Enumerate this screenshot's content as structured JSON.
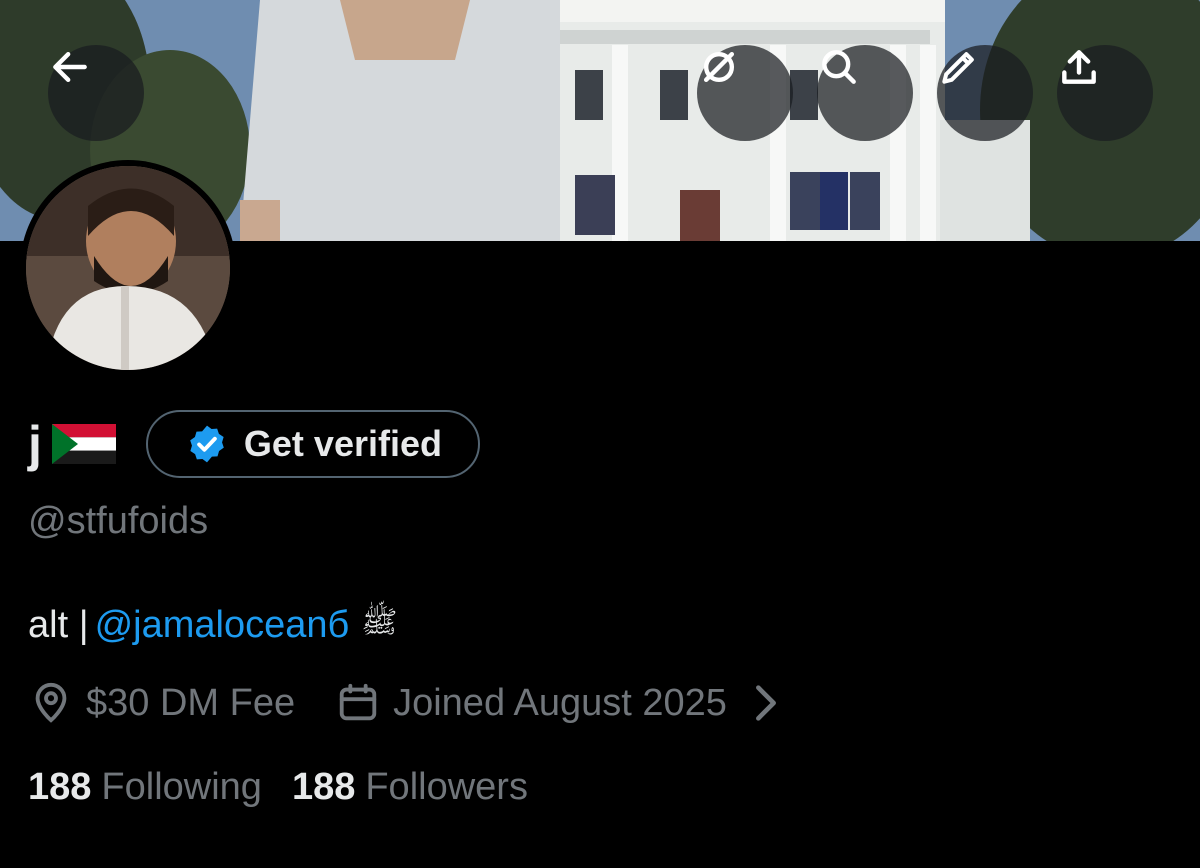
{
  "profile": {
    "display_name": "j",
    "flag_emoji": "sudan-flag",
    "get_verified_label": "Get verified",
    "handle": "@stfufoids",
    "bio_prefix": "alt |",
    "bio_mention": "@jamaloceanб",
    "bio_symbol": "ﷺ",
    "location": "$30 DM Fee",
    "joined": "Joined August 2025",
    "following_count": "188",
    "following_label": "Following",
    "followers_count": "188",
    "followers_label": "Followers"
  },
  "header_icons": [
    "back-arrow-icon",
    "grok-icon",
    "search-icon",
    "pencil-icon",
    "share-icon"
  ],
  "colors": {
    "background": "#000000",
    "primary_text": "#e7e9ea",
    "secondary_text": "#71767b",
    "link": "#1d9bf0",
    "verified_badge": "#1d9bf0",
    "button_border": "#536471"
  }
}
